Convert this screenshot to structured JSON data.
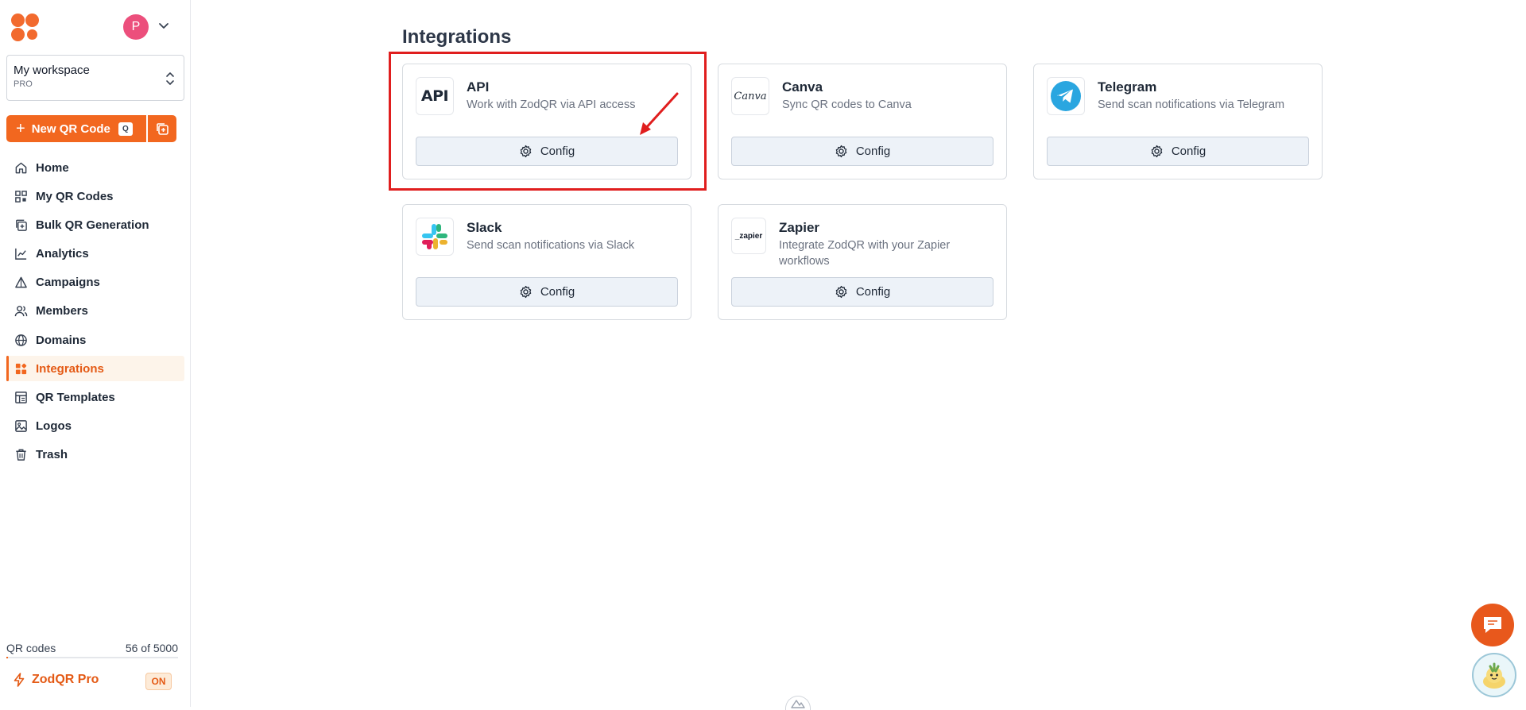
{
  "user": {
    "avatar_letter": "P"
  },
  "workspace": {
    "name": "My workspace",
    "plan": "PRO"
  },
  "new_qr": {
    "label": "New QR Code",
    "shortcut": "Q"
  },
  "nav": [
    {
      "label": "Home",
      "icon": "home-icon"
    },
    {
      "label": "My QR Codes",
      "icon": "qr-grid-icon"
    },
    {
      "label": "Bulk QR Generation",
      "icon": "bulk-copy-icon"
    },
    {
      "label": "Analytics",
      "icon": "analytics-icon"
    },
    {
      "label": "Campaigns",
      "icon": "campaigns-icon"
    },
    {
      "label": "Members",
      "icon": "members-icon"
    },
    {
      "label": "Domains",
      "icon": "globe-icon"
    },
    {
      "label": "Integrations",
      "icon": "integrations-icon",
      "active": true
    },
    {
      "label": "QR Templates",
      "icon": "templates-icon"
    },
    {
      "label": "Logos",
      "icon": "image-icon"
    },
    {
      "label": "Trash",
      "icon": "trash-icon"
    }
  ],
  "quota": {
    "label": "QR codes",
    "value": "56 of 5000",
    "used_fraction": 0.0112
  },
  "pro": {
    "label": "ZodQR Pro",
    "status": "ON"
  },
  "page": {
    "title": "Integrations"
  },
  "integrations": [
    {
      "name": "API",
      "description": "Work with ZodQR via API access",
      "button": "Config",
      "logo_text": "API"
    },
    {
      "name": "Canva",
      "description": "Sync QR codes to Canva",
      "button": "Config",
      "logo_text": "Canva"
    },
    {
      "name": "Telegram",
      "description": "Send scan notifications via Telegram",
      "button": "Config"
    },
    {
      "name": "Slack",
      "description": "Send scan notifications via Slack",
      "button": "Config"
    },
    {
      "name": "Zapier",
      "description": "Integrate ZodQR with your Zapier workflows",
      "button": "Config",
      "logo_text": "_zapier"
    }
  ],
  "colors": {
    "brand": "#f2671f",
    "annotation": "#e01e1e"
  }
}
